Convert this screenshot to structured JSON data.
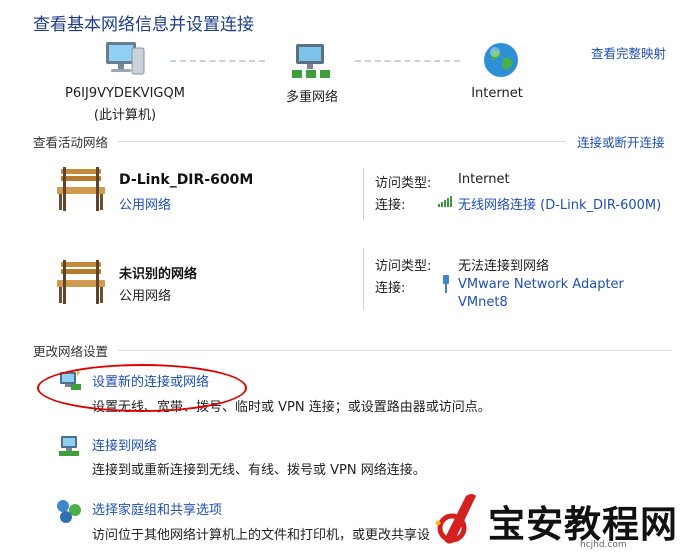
{
  "page_title": "查看基本网络信息并设置连接",
  "map": {
    "computer_name": "P6IJ9VYDEKVIGQM",
    "computer_sub": "(此计算机)",
    "network_label": "多重网络",
    "internet_label": "Internet",
    "full_map_link": "查看完整映射"
  },
  "active_networks": {
    "header": "查看活动网络",
    "connect_link": "连接或断开连接",
    "items": [
      {
        "name": "D-Link_DIR-600M",
        "type_link": "公用网络",
        "access_label": "访问类型:",
        "access_value": "Internet",
        "conn_label": "连接:",
        "conn_value": "无线网络连接 (D-Link_DIR-600M)"
      },
      {
        "name": "未识别的网络",
        "type_text": "公用网络",
        "access_label": "访问类型:",
        "access_value": "无法连接到网络",
        "conn_label": "连接:",
        "conn_value_line1": "VMware Network Adapter",
        "conn_value_line2": "VMnet8"
      }
    ]
  },
  "change_settings": {
    "header": "更改网络设置",
    "tasks": [
      {
        "link": "设置新的连接或网络",
        "desc": "设置无线、宽带、拨号、临时或 VPN 连接；或设置路由器或访问点。"
      },
      {
        "link": "连接到网络",
        "desc": "连接到或重新连接到无线、有线、拨号或 VPN 网络连接。"
      },
      {
        "link": "选择家庭组和共享选项",
        "desc": "访问位于其他网络计算机上的文件和打印机，或更改共享设"
      }
    ]
  },
  "watermark": {
    "text": "宝安教程网",
    "sub": "hcjhd.com"
  },
  "colors": {
    "link": "#1f4fb5",
    "title": "#1e3c8c",
    "highlight": "#e00000"
  }
}
